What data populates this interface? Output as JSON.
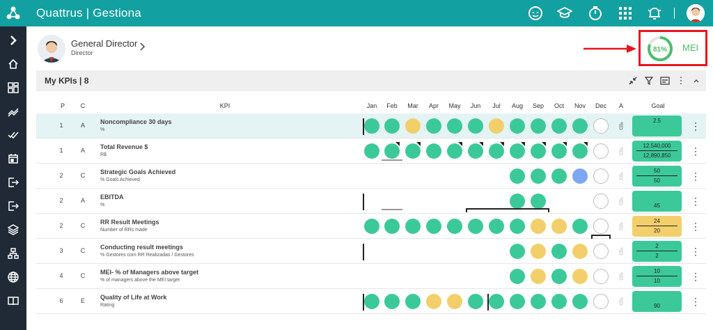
{
  "app": {
    "title": "Quattrus | Gestiona"
  },
  "user": {
    "name": "General Director",
    "role": "Director"
  },
  "mei": {
    "percent": "81%",
    "label": "MEI",
    "value": 0.81
  },
  "kpis": {
    "title": "My KPIs | 8",
    "columns": {
      "p": "P",
      "c": "C",
      "kpi": "KPI",
      "a": "A",
      "goal": "Goal"
    },
    "months": [
      "Jan",
      "Feb",
      "Mar",
      "Apr",
      "May",
      "Jun",
      "Jul",
      "Aug",
      "Sep",
      "Oct",
      "Nov",
      "Dec"
    ],
    "rows": [
      {
        "p": "1",
        "c": "A",
        "name": "Noncompliance 30 days",
        "sub": "%",
        "goal_top": "2.5",
        "goal_bottom": "",
        "goal_color": "green"
      },
      {
        "p": "1",
        "c": "A",
        "name": "Total Revenue $",
        "sub": "R$",
        "goal_top": "12,540,000",
        "goal_bottom": "12,890,850",
        "goal_color": "green"
      },
      {
        "p": "2",
        "c": "C",
        "name": "Strategic Goals Achieved",
        "sub": "% Goals Achieved",
        "goal_top": "50",
        "goal_bottom": "50",
        "goal_color": "green"
      },
      {
        "p": "2",
        "c": "A",
        "name": "EBITDA",
        "sub": "%",
        "goal_top": "",
        "goal_bottom": "45",
        "goal_color": "green"
      },
      {
        "p": "2",
        "c": "C",
        "name": "RR Result Meetings",
        "sub": "Number of RRs made",
        "goal_top": "24",
        "goal_bottom": "20",
        "goal_color": "yellow"
      },
      {
        "p": "3",
        "c": "C",
        "name": "Conducting result meetings",
        "sub": "% Gestores com RR Realizadas / Gestores",
        "goal_top": "2",
        "goal_bottom": "2",
        "goal_color": "green"
      },
      {
        "p": "4",
        "c": "C",
        "name": "MEI- % of Managers above target",
        "sub": "% of managers above the MEI target",
        "goal_top": "10",
        "goal_bottom": "10",
        "goal_color": "green"
      },
      {
        "p": "6",
        "c": "E",
        "name": "Quality of Life at Work",
        "sub": "Rating",
        "goal_top": "",
        "goal_bottom": "90",
        "goal_color": "green"
      }
    ]
  },
  "status_colors": {
    "green": "#3cc99a",
    "yellow": "#f3cf6b",
    "blue": "#7ea6f2"
  },
  "icons": {
    "topbar": [
      "support-icon",
      "graduation-cap-icon",
      "stopwatch-icon",
      "apps-grid-icon",
      "bell-icon",
      "user-avatar-icon"
    ],
    "sidebar": [
      "chevron-right-icon",
      "home-icon",
      "dashboard-icon",
      "trend-icon",
      "check-double-icon",
      "calendar-icon",
      "exit-icon",
      "logout-icon",
      "layers-icon",
      "org-chart-icon",
      "globe-icon",
      "book-icon"
    ]
  }
}
